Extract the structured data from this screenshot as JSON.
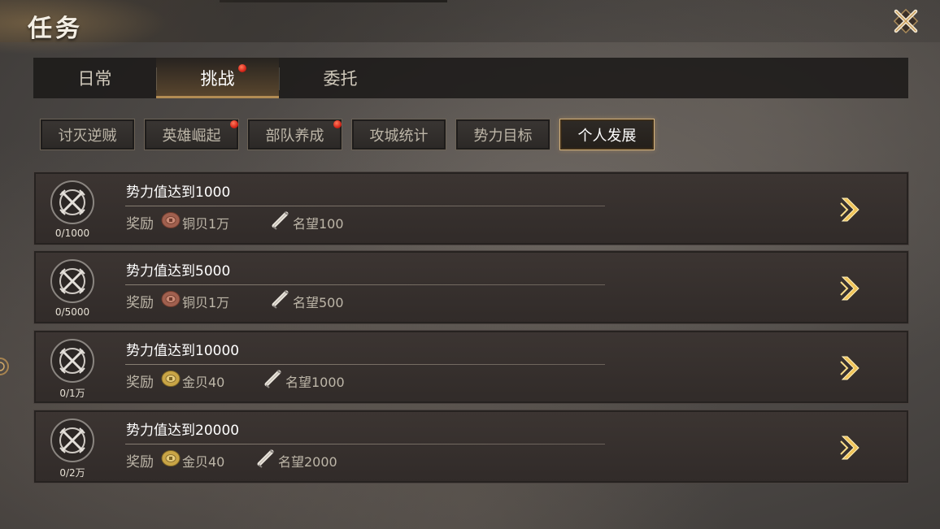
{
  "header": {
    "title": "任务"
  },
  "tabs": [
    {
      "label": "日常",
      "active": false,
      "badge": false
    },
    {
      "label": "挑战",
      "active": true,
      "badge": true
    },
    {
      "label": "委托",
      "active": false,
      "badge": false
    }
  ],
  "subtabs": [
    {
      "label": "讨灭逆贼",
      "active": false,
      "badge": false
    },
    {
      "label": "英雄崛起",
      "active": false,
      "badge": true
    },
    {
      "label": "部队养成",
      "active": false,
      "badge": true
    },
    {
      "label": "攻城统计",
      "active": false,
      "badge": false
    },
    {
      "label": "势力目标",
      "active": false,
      "badge": false
    },
    {
      "label": "个人发展",
      "active": true,
      "badge": false
    }
  ],
  "tasks": [
    {
      "title": "势力值达到1000",
      "progress": "0/1000",
      "reward_label": "奖励",
      "reward1_icon": "copper-coin-icon",
      "reward1": "铜贝1万",
      "reward2_icon": "scroll-icon",
      "reward2": "名望100"
    },
    {
      "title": "势力值达到5000",
      "progress": "0/5000",
      "reward_label": "奖励",
      "reward1_icon": "copper-coin-icon",
      "reward1": "铜贝1万",
      "reward2_icon": "scroll-icon",
      "reward2": "名望500"
    },
    {
      "title": "势力值达到10000",
      "progress": "0/1万",
      "reward_label": "奖励",
      "reward1_icon": "gold-coin-icon",
      "reward1": "金贝40",
      "reward2_icon": "scroll-icon",
      "reward2": "名望1000"
    },
    {
      "title": "势力值达到20000",
      "progress": "0/2万",
      "reward_label": "奖励",
      "reward1_icon": "gold-coin-icon",
      "reward1": "金贝40",
      "reward2_icon": "scroll-icon",
      "reward2": "名望2000"
    }
  ],
  "colors": {
    "accent_gold": "#e8b84a",
    "badge_red": "#d7261a",
    "copper": "#a0604f",
    "gold": "#c9a546"
  }
}
